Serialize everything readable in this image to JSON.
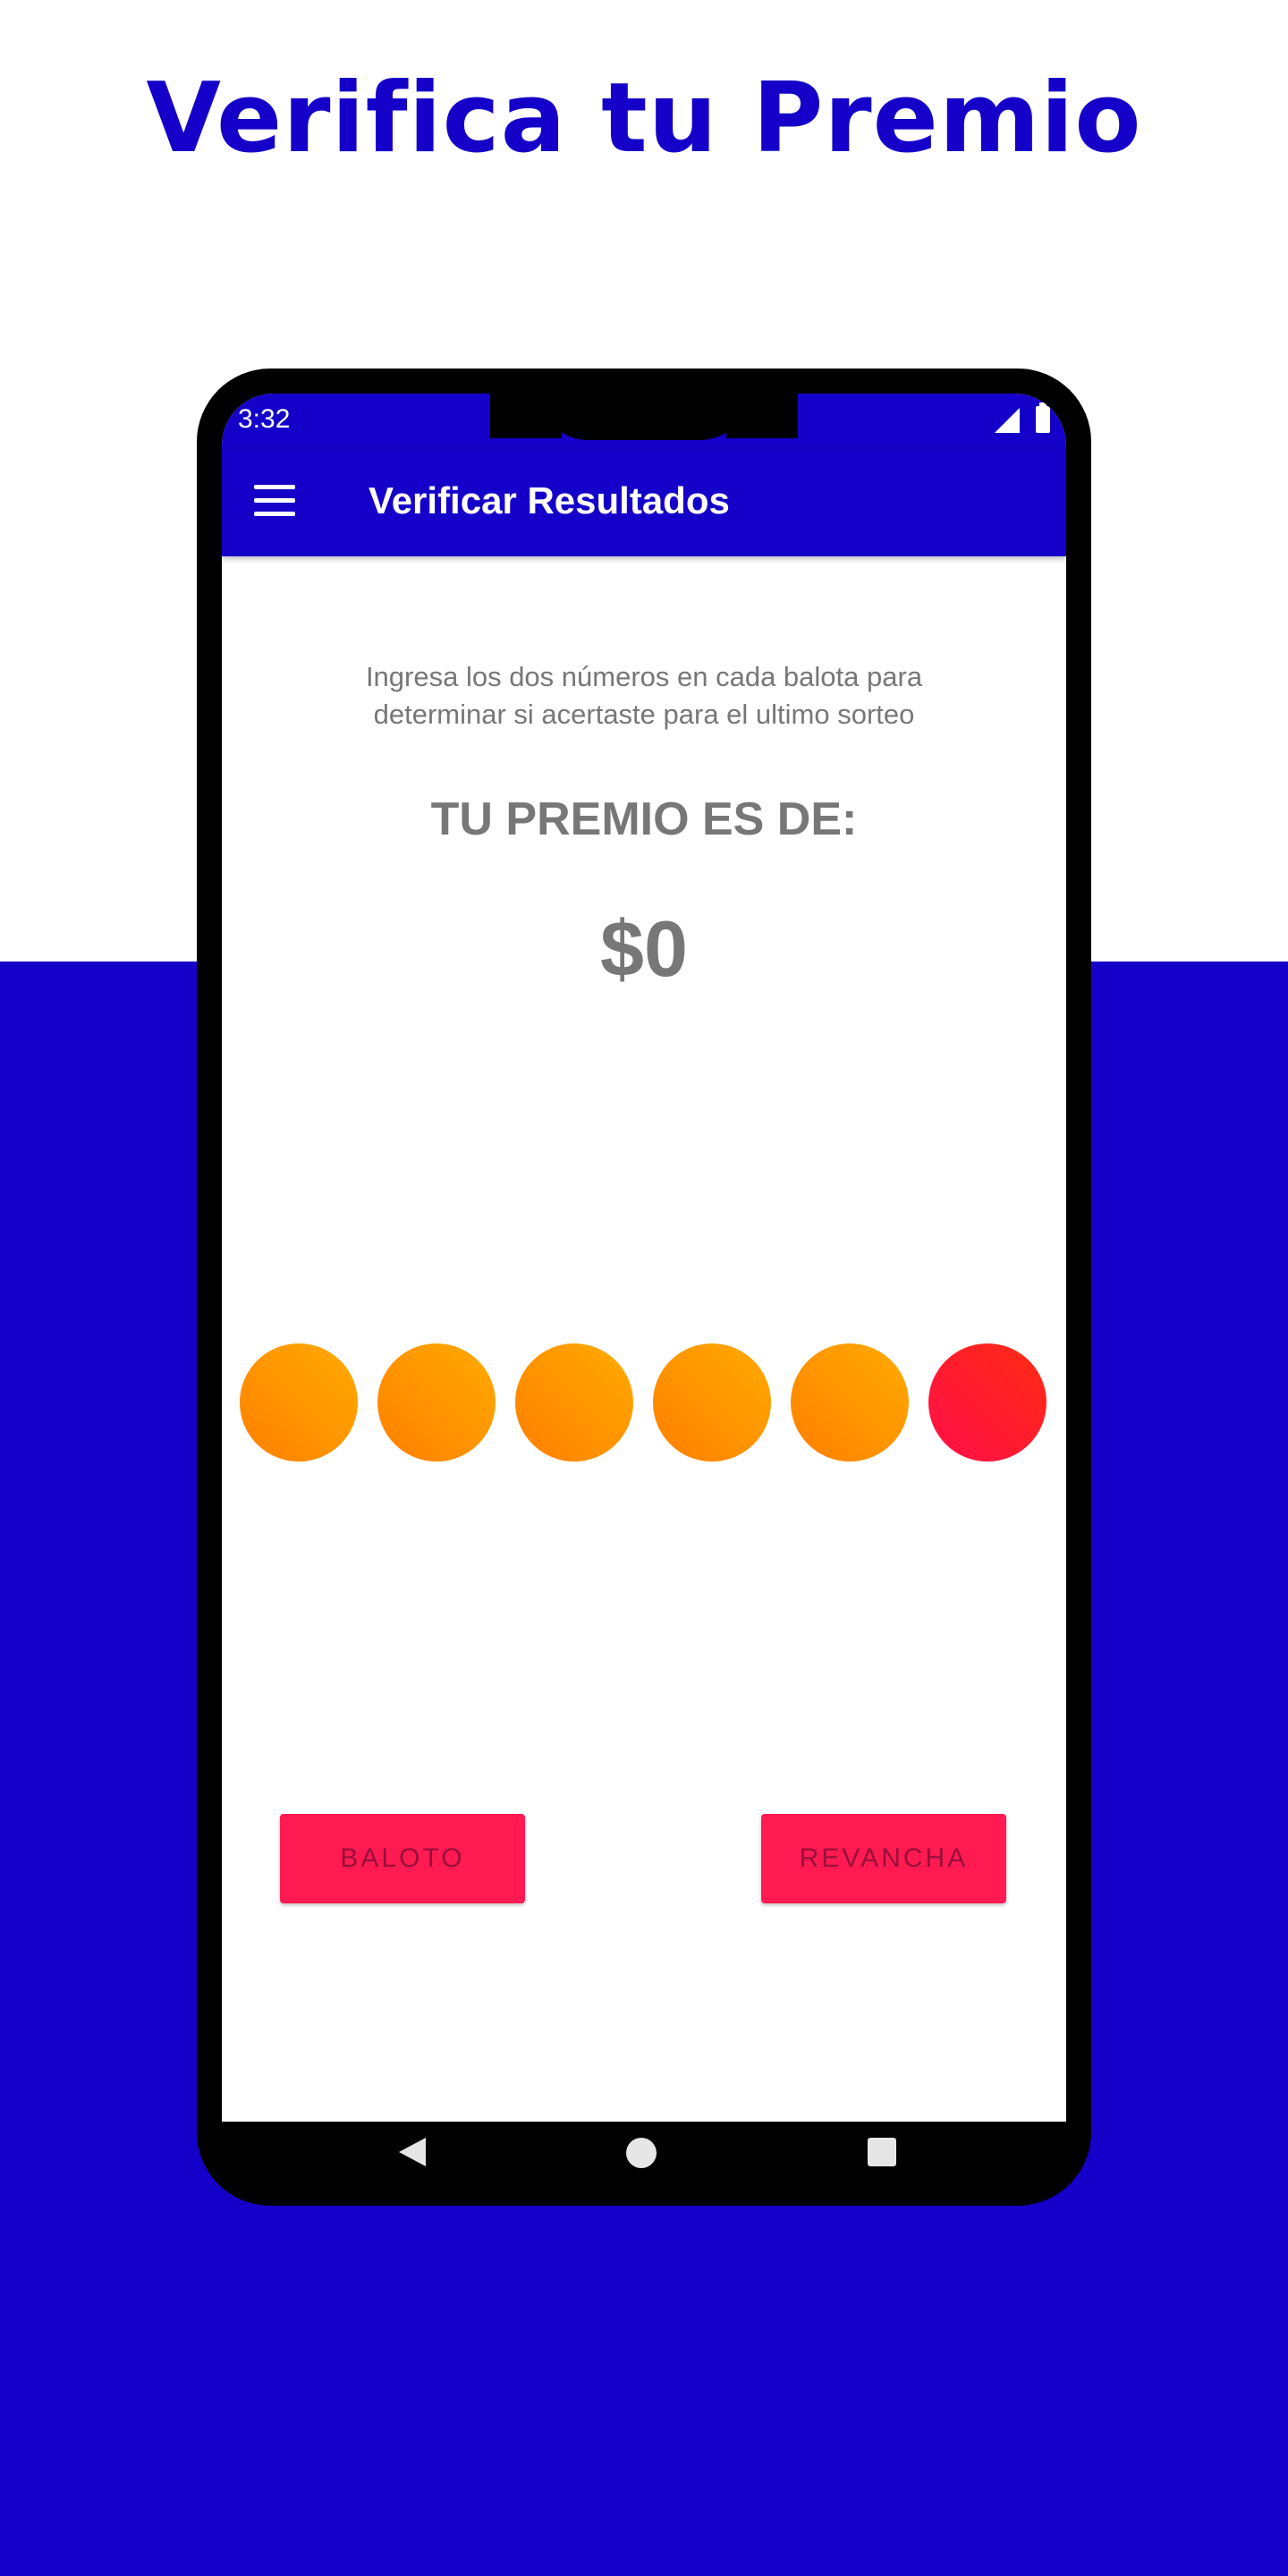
{
  "headline": "Verifica tu Premio",
  "status_bar": {
    "time": "3:32",
    "icons": [
      "signal-icon",
      "battery-icon"
    ]
  },
  "app_bar": {
    "menu_icon": "menu-icon",
    "title": "Verificar Resultados"
  },
  "main": {
    "instructions": "Ingresa los dos números en cada balota para determinar si acertaste para el ultimo sorteo",
    "prize_label": "TU PREMIO ES DE:",
    "prize_value": "$0",
    "balls": [
      {
        "color": "orange"
      },
      {
        "color": "orange"
      },
      {
        "color": "orange"
      },
      {
        "color": "orange"
      },
      {
        "color": "orange"
      },
      {
        "color": "red"
      }
    ]
  },
  "buttons": {
    "baloto": "BALOTO",
    "revancha": "REVANCHA"
  },
  "nav_bar": {
    "icons": [
      "back-icon",
      "home-icon",
      "recents-icon"
    ]
  },
  "colors": {
    "brand_blue": "#1400c8",
    "button_red": "#ff1a52",
    "ball_orange": "#ff9500",
    "ball_red": "#ff1a3a"
  }
}
